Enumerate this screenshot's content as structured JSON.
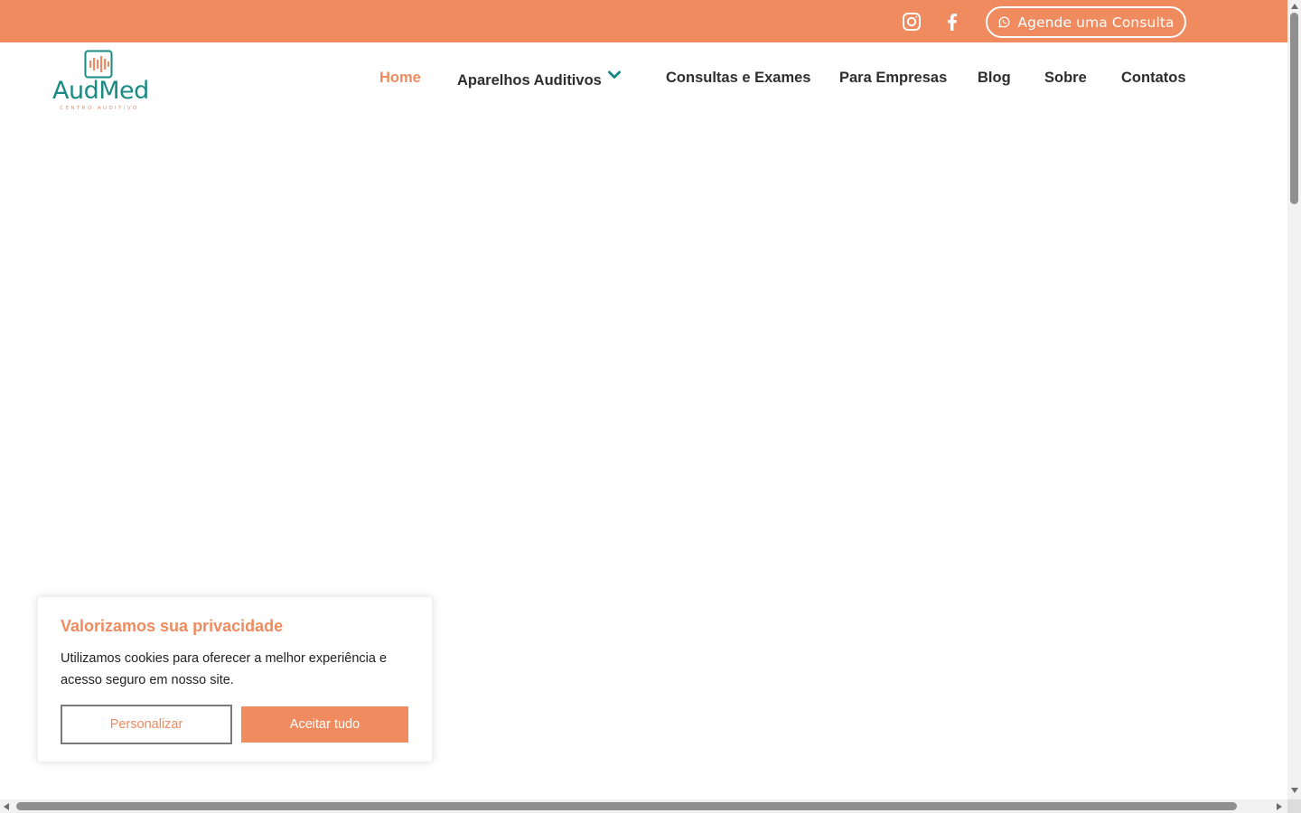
{
  "topbar": {
    "social": [
      {
        "icon": "instagram-icon"
      },
      {
        "icon": "facebook-icon"
      }
    ],
    "cta_label": "Agende uma Consulta",
    "cta_icon": "whatsapp-icon"
  },
  "header": {
    "logo_text": "AudMed",
    "logo_subtitle": "CENTRO AUDITIVO",
    "logo_icon": "sound-wave-icon",
    "nav": [
      {
        "label": "Home",
        "active": true
      },
      {
        "label": "Aparelhos Auditivos",
        "has_dropdown": true,
        "dropdown_icon": "chevron-down-icon"
      },
      {
        "label": "Consultas e Exames"
      },
      {
        "label": "Para Empresas"
      },
      {
        "label": "Blog"
      },
      {
        "label": "Sobre"
      },
      {
        "label": "Contatos"
      }
    ]
  },
  "cookie_banner": {
    "title": "Valorizamos sua privacidade",
    "text": "Utilizamos cookies para oferecer a melhor experiência e acesso seguro em nosso site.",
    "customize_label": "Personalizar",
    "accept_label": "Aceitar tudo"
  },
  "colors": {
    "accent": "#ef8b5f",
    "brand_teal": "#1a8a83",
    "nav_text": "#2e2e2e"
  }
}
